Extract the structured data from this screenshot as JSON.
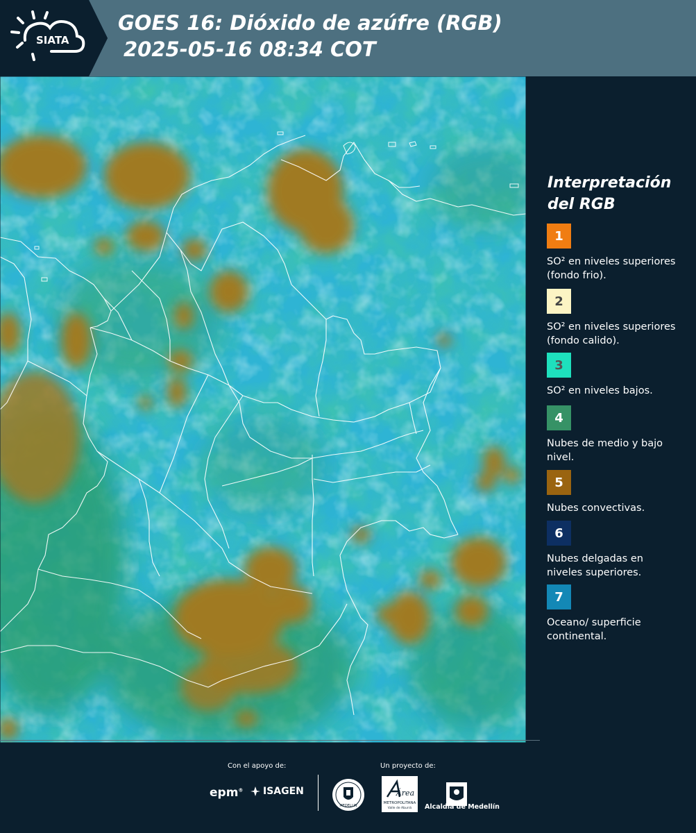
{
  "header": {
    "logo_text": "SIATA",
    "title_line1": "GOES 16: Dióxido de azúfre (RGB)",
    "title_line2": "2025-05-16 08:34 COT",
    "band_color": "#4d7080",
    "dark_color": "#0b1f2e"
  },
  "map": {
    "product": "GOES 16 Sulfur Dioxide RGB composite",
    "region": "Colombia and northern South America",
    "boundary_color": "#ffffff",
    "palette": [
      "#2ab0d0",
      "#2a9a70",
      "#a07820"
    ]
  },
  "legend": {
    "title_line1": "Interpretación",
    "title_line2": "del RGB",
    "items": [
      {
        "number": "1",
        "color": "#f07d12",
        "number_color": "#ffffff",
        "label": "SO² en niveles superiores (fondo frio)."
      },
      {
        "number": "2",
        "color": "#fcf4c4",
        "number_color": "#444444",
        "label": "SO² en niveles superiores (fondo calido)."
      },
      {
        "number": "3",
        "color": "#1ee0bd",
        "number_color": "#555555",
        "label": "SO² en niveles bajos."
      },
      {
        "number": "4",
        "color": "#369266",
        "number_color": "#ffffff",
        "label": "Nubes de medio y bajo nivel."
      },
      {
        "number": "5",
        "color": "#9a6410",
        "number_color": "#ffffff",
        "label": "Nubes convectivas."
      },
      {
        "number": "6",
        "color": "#0d2f62",
        "number_color": "#ffffff",
        "label": "Nubes delgadas en niveles superiores."
      },
      {
        "number": "7",
        "color": "#1388b6",
        "number_color": "#ffffff",
        "label": "Oceano/ superficie continental."
      }
    ]
  },
  "footer": {
    "support_caption": "Con el apoyo de:",
    "project_caption": "Un proyecto de:",
    "epm_logo": "epm",
    "isagen_logo": "ISAGEN",
    "area_logo_text": "Área",
    "area_logo_sub": "METROPOLITANA",
    "area_logo_sub2": "Valle de Aburrá",
    "alcaldia_logo": "Alcaldía de Medellín",
    "seal_text": "MEDELLIN"
  }
}
